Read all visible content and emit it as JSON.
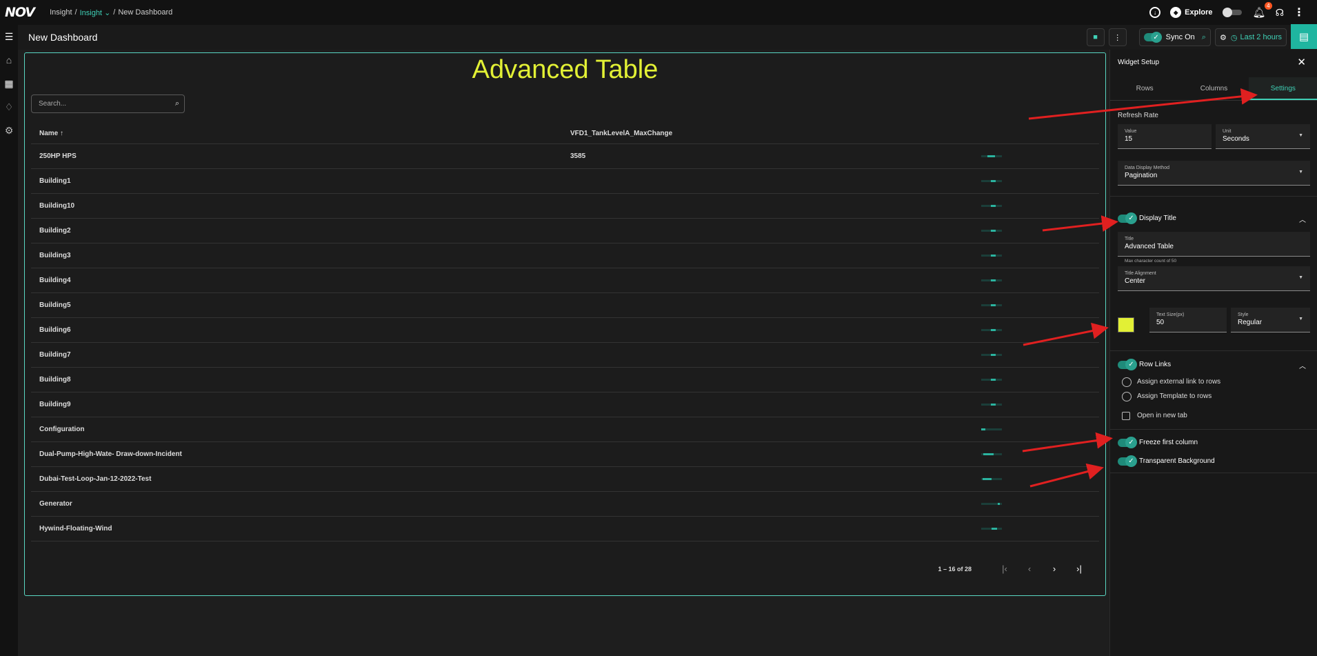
{
  "app": {
    "logo_text": "NOV",
    "breadcrumb": [
      "Insight",
      "/",
      "Insight",
      "/",
      "New Dashboard"
    ],
    "explore_label": "Explore",
    "notification_count": "4"
  },
  "dashboard": {
    "title": "New Dashboard",
    "sync_label": "Sync On",
    "time_range_label": "Last 2 hours"
  },
  "widget": {
    "title": "Advanced Table",
    "title_color": "#e2f035",
    "search_placeholder": "Search...",
    "columns": [
      "Name",
      "VFD1_TankLevelA_MaxChange"
    ],
    "rows": [
      {
        "name": "250HP HPS",
        "value": "3585",
        "spark": [
          0.3,
          0.35
        ]
      },
      {
        "name": "Building1",
        "value": "",
        "spark": [
          0.45,
          0.25
        ]
      },
      {
        "name": "Building10",
        "value": "",
        "spark": [
          0.45,
          0.25
        ]
      },
      {
        "name": "Building2",
        "value": "",
        "spark": [
          0.45,
          0.25
        ]
      },
      {
        "name": "Building3",
        "value": "",
        "spark": [
          0.45,
          0.25
        ]
      },
      {
        "name": "Building4",
        "value": "",
        "spark": [
          0.45,
          0.25
        ]
      },
      {
        "name": "Building5",
        "value": "",
        "spark": [
          0.45,
          0.25
        ]
      },
      {
        "name": "Building6",
        "value": "",
        "spark": [
          0.45,
          0.25
        ]
      },
      {
        "name": "Building7",
        "value": "",
        "spark": [
          0.45,
          0.25
        ]
      },
      {
        "name": "Building8",
        "value": "",
        "spark": [
          0.45,
          0.25
        ]
      },
      {
        "name": "Building9",
        "value": "",
        "spark": [
          0.45,
          0.25
        ]
      },
      {
        "name": "Configuration",
        "value": "",
        "spark": [
          0.0,
          0.2
        ]
      },
      {
        "name": "Dual-Pump-High-Wate- Draw-down-Incident",
        "value": "",
        "spark": [
          0.1,
          0.5
        ]
      },
      {
        "name": "Dubai-Test-Loop-Jan-12-2022-Test",
        "value": "",
        "spark": [
          0.05,
          0.45
        ]
      },
      {
        "name": "Generator",
        "value": "",
        "spark": [
          0.8,
          0.1
        ]
      },
      {
        "name": "Hywind-Floating-Wind",
        "value": "",
        "spark": [
          0.5,
          0.25
        ]
      }
    ],
    "pagination_text": "1 – 16 of 28"
  },
  "setup_panel": {
    "heading": "Widget Setup",
    "tabs": [
      "Rows",
      "Columns",
      "Settings"
    ],
    "active_tab": "Settings",
    "refresh_rate_label": "Refresh Rate",
    "value_field": {
      "label": "Value",
      "value": "15"
    },
    "unit_field": {
      "label": "Unit",
      "value": "Seconds"
    },
    "display_method_field": {
      "label": "Data Display Method",
      "value": "Pagination"
    },
    "display_title_label": "Display Title",
    "title_field": {
      "label": "Title",
      "value": "Advanced Table"
    },
    "title_hint": "Max character count of 50",
    "title_alignment_field": {
      "label": "Title Alignment",
      "value": "Center"
    },
    "text_size_field": {
      "label": "Text Size(px)",
      "value": "50"
    },
    "style_field": {
      "label": "Style",
      "value": "Regular"
    },
    "row_links_label": "Row Links",
    "assign_external_label": "Assign external link to rows",
    "assign_template_label": "Assign Template to rows",
    "open_new_tab_label": "Open in new tab",
    "freeze_label": "Freeze first column",
    "transparent_label": "Transparent Background"
  },
  "colors": {
    "accent": "#3fd0b6",
    "annotation_arrow": "#e02020"
  }
}
